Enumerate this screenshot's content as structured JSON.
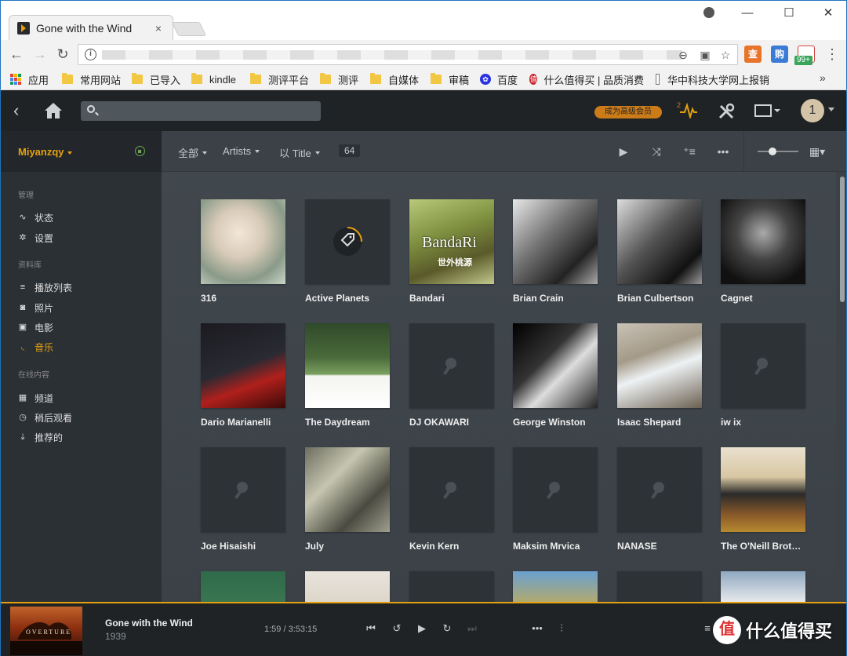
{
  "browser": {
    "tab_title": "Gone with the Wind",
    "tab_close": "×",
    "window_controls": [
      "—",
      "☐",
      "✕"
    ],
    "bookmarks": [
      {
        "label": "应用",
        "icon": "apps-icon"
      },
      {
        "label": "常用网站",
        "icon": "folder-icon"
      },
      {
        "label": "已导入",
        "icon": "folder-icon"
      },
      {
        "label": "kindle",
        "icon": "folder-icon"
      },
      {
        "label": "测评平台",
        "icon": "folder-icon"
      },
      {
        "label": "测评",
        "icon": "folder-icon"
      },
      {
        "label": "自媒体",
        "icon": "folder-icon"
      },
      {
        "label": "审稿",
        "icon": "folder-icon"
      },
      {
        "label": "百度",
        "icon": "baidu-icon"
      },
      {
        "label": "什么值得买 | 品质消费",
        "icon": "smzdm-icon"
      },
      {
        "label": "华中科技大学网上报销",
        "icon": "page-icon"
      }
    ],
    "bookmarks_more": "»",
    "extension_badge": "99+",
    "ext_labels": [
      "查",
      "购"
    ]
  },
  "app": {
    "premium_label": "成为高级会员",
    "activity_count": "2",
    "user_initial": "1",
    "accent": "#e5a00d",
    "sidebar": {
      "user": "Miyanzqy",
      "sections": {
        "manage": "管理",
        "library": "资料库",
        "online": "在线内容"
      },
      "manage_items": [
        {
          "label": "状态",
          "icon": "pulse-icon"
        },
        {
          "label": "设置",
          "icon": "gear-icon"
        }
      ],
      "library_items": [
        {
          "label": "播放列表",
          "icon": "list-icon"
        },
        {
          "label": "照片",
          "icon": "camera-icon"
        },
        {
          "label": "电影",
          "icon": "film-icon"
        },
        {
          "label": "音乐",
          "icon": "music-icon",
          "active": true
        }
      ],
      "online_items": [
        {
          "label": "频道",
          "icon": "grid-icon"
        },
        {
          "label": "稍后观看",
          "icon": "clock-icon"
        },
        {
          "label": "推荐的",
          "icon": "download-icon"
        }
      ]
    },
    "filter_bar": {
      "all": "全部",
      "type": "Artists",
      "sort": "以 Title",
      "count": "64"
    },
    "artists": [
      {
        "name": "316",
        "art": "photo"
      },
      {
        "name": "Active Planets",
        "art": "tag"
      },
      {
        "name": "Bandari",
        "art": "photo"
      },
      {
        "name": "Brian Crain",
        "art": "photo"
      },
      {
        "name": "Brian Culbertson",
        "art": "photo"
      },
      {
        "name": "Cagnet",
        "art": "photo"
      },
      {
        "name": "Dario Marianelli",
        "art": "photo"
      },
      {
        "name": "The Daydream",
        "art": "photo"
      },
      {
        "name": "DJ OKAWARI",
        "art": "placeholder"
      },
      {
        "name": "George Winston",
        "art": "photo"
      },
      {
        "name": "Isaac Shepard",
        "art": "photo"
      },
      {
        "name": "iw ix",
        "art": "placeholder"
      },
      {
        "name": "Joe Hisaishi",
        "art": "placeholder"
      },
      {
        "name": "July",
        "art": "photo"
      },
      {
        "name": "Kevin Kern",
        "art": "placeholder"
      },
      {
        "name": "Maksim Mrvica",
        "art": "placeholder"
      },
      {
        "name": "NANASE",
        "art": "placeholder"
      },
      {
        "name": "The O'Neill Brothers",
        "art": "photo"
      },
      {
        "name": "",
        "art": "photo"
      },
      {
        "name": "",
        "art": "photo"
      },
      {
        "name": "",
        "art": "placeholder"
      },
      {
        "name": "",
        "art": "photo"
      },
      {
        "name": "",
        "art": "placeholder"
      },
      {
        "name": "",
        "art": "photo"
      }
    ],
    "bandari_cover_text": "世外桃源",
    "bandari_logo_text": "BandaRi",
    "player": {
      "title": "Gone with the Wind",
      "year": "1939",
      "time": "1:59 / 3:53:15",
      "art_text": "OVERTURE"
    },
    "watermark": {
      "badge": "值",
      "text": "什么值得买"
    }
  }
}
